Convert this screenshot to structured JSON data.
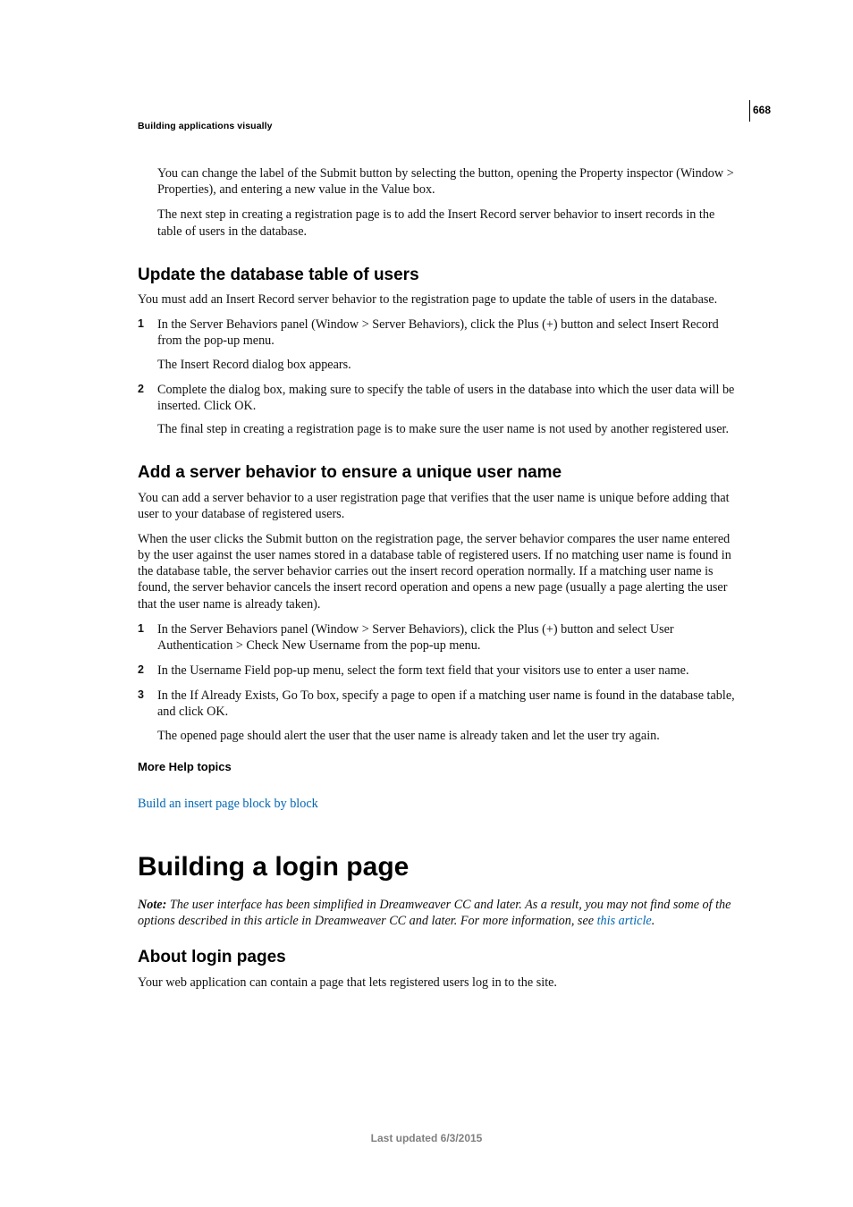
{
  "page_number": "668",
  "running_head": "Building applications visually",
  "intro_block": {
    "p1": "You can change the label of the Submit button by selecting the button, opening the Property inspector (Window > Properties), and entering a new value in the Value box.",
    "p2": "The next step in creating a registration page is to add the Insert Record server behavior to insert records in the table of users in the database."
  },
  "section1": {
    "heading": "Update the database table of users",
    "intro": "You must add an Insert Record server behavior to the registration page to update the table of users in the database.",
    "steps": [
      {
        "main": "In the Server Behaviors panel (Window > Server Behaviors), click the Plus (+) button and select Insert Record from the pop-up menu.",
        "sub": "The Insert Record dialog box appears."
      },
      {
        "main": "Complete the dialog box, making sure to specify the table of users in the database into which the user data will be inserted. Click OK.",
        "sub": "The final step in creating a registration page is to make sure the user name is not used by another registered user."
      }
    ]
  },
  "section2": {
    "heading": "Add a server behavior to ensure a unique user name",
    "p1": "You can add a server behavior to a user registration page that verifies that the user name is unique before adding that user to your database of registered users.",
    "p2": "When the user clicks the Submit button on the registration page, the server behavior compares the user name entered by the user against the user names stored in a database table of registered users. If no matching user name is found in the database table, the server behavior carries out the insert record operation normally. If a matching user name is found, the server behavior cancels the insert record operation and opens a new page (usually a page alerting the user that the user name is already taken).",
    "steps": [
      {
        "main": "In the Server Behaviors panel (Window > Server Behaviors), click the Plus (+) button and select User Authentication > Check New Username from the pop-up menu."
      },
      {
        "main": "In the Username Field pop-up menu, select the form text field that your visitors use to enter a user name."
      },
      {
        "main": "In the If Already Exists, Go To box, specify a page to open if a matching user name is found in the database table, and click OK.",
        "sub": "The opened page should alert the user that the user name is already taken and let the user try again."
      }
    ],
    "more_help_heading": "More Help topics",
    "more_help_link": "Build an insert page block by block"
  },
  "chapter": {
    "heading": "Building a login page",
    "note_label": "Note:",
    "note_text_1": " The user interface has been simplified in Dreamweaver CC and later. As a result, you may not find some of the options described in this article in Dreamweaver CC and later. For more information, see ",
    "note_link": "this article",
    "note_text_2": ".",
    "sub_heading": "About login pages",
    "sub_p1": "Your web application can contain a page that lets registered users log in to the site."
  },
  "footer": "Last updated 6/3/2015"
}
